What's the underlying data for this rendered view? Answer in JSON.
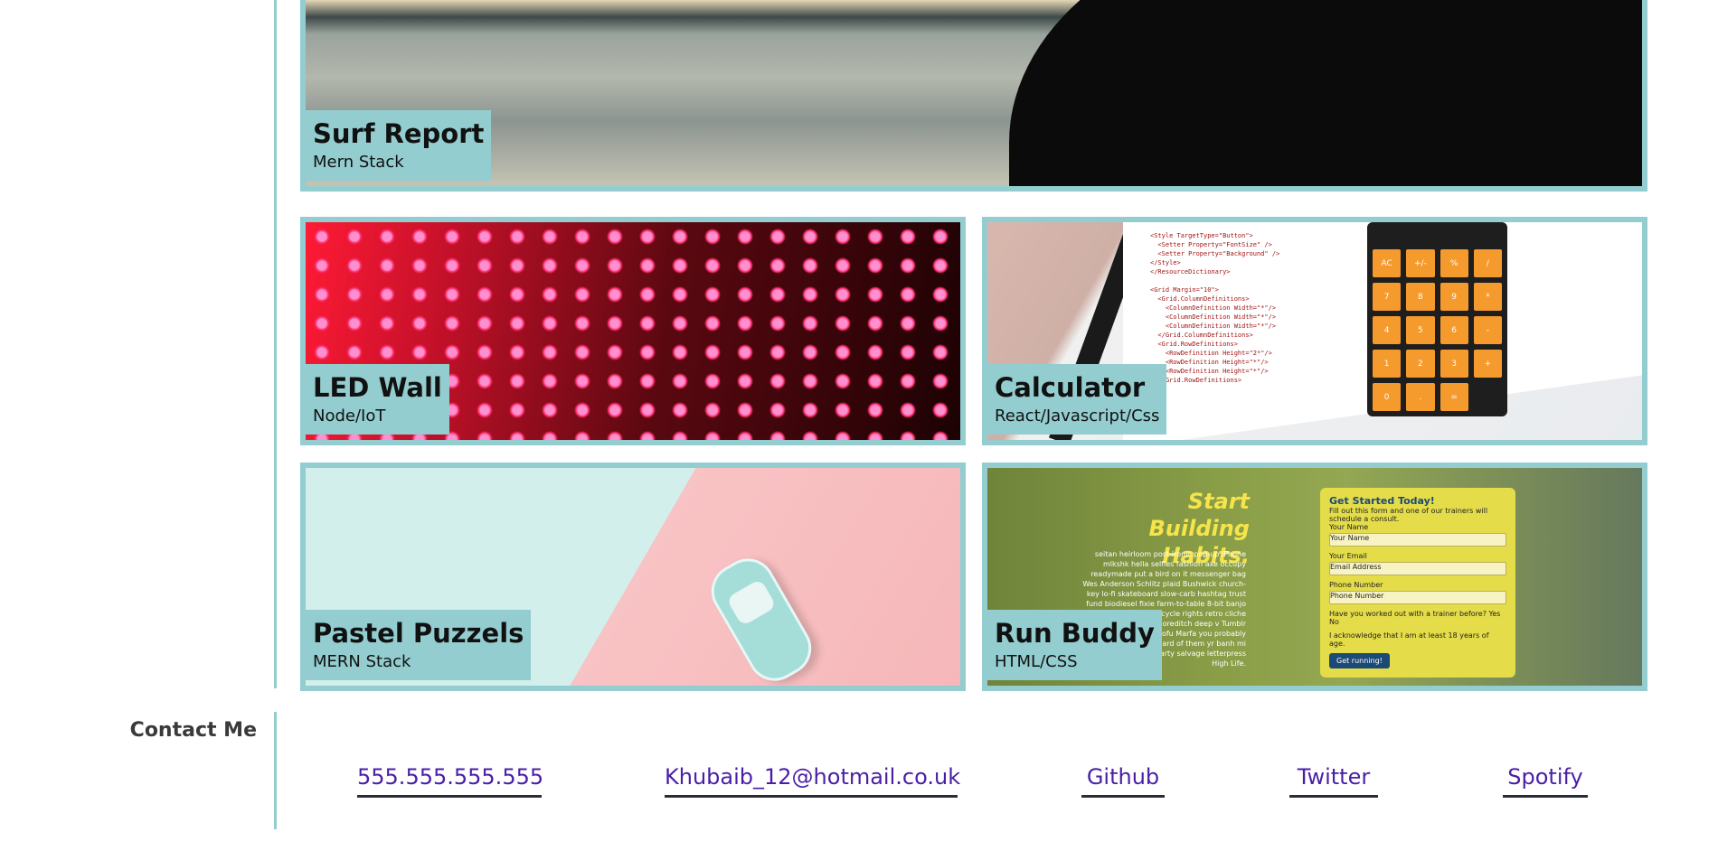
{
  "projects": [
    {
      "title": "Surf Report",
      "subtitle": "Mern Stack"
    },
    {
      "title": "LED Wall",
      "subtitle": "Node/IoT"
    },
    {
      "title": "Calculator",
      "subtitle": "React/Javascript/Css"
    },
    {
      "title": "Pastel Puzzels",
      "subtitle": "MERN Stack"
    },
    {
      "title": "Run Buddy",
      "subtitle": "HTML/CSS"
    }
  ],
  "runbuddy_art": {
    "headline": "Start Building Habits.",
    "paragraph": "seitan heirloom post-ironic pop-up iPhone mlkshk hella selfies fashion axe occupy readymade put a bird on it messenger bag Wes Anderson Schlitz plaid Bushwick church-key lo-fi skateboard slow-carb hashtag trust fund biodiesel fixie farm-to-table 8-bit banjo Banksy chillwave bicycle rights retro cliche irony mumblecore Shoreditch deep v Tumblr bitters cray gentrify tofu Marfa you probably haven't heard of them yr banh mi asymmetrical art party salvage letterpress High Life.",
    "form_title": "Get Started Today!",
    "form_intro": "Fill out this form and one of our trainers will schedule a consult.",
    "field_name": "Your Name",
    "field_name_placeholder": "Your Name",
    "field_email": "Your Email",
    "field_email_placeholder": "Email Address",
    "field_phone": "Phone Number",
    "field_phone_placeholder": "Phone Number",
    "question": "Have you worked out with a trainer before?",
    "yes": "Yes",
    "no": "No",
    "ack": "I acknowledge that I am at least 18 years of age.",
    "button": "Get running!"
  },
  "calc_keys": [
    "AC",
    "+/-",
    "%",
    "/",
    "7",
    "8",
    "9",
    "*",
    "4",
    "5",
    "6",
    "-",
    "1",
    "2",
    "3",
    "+",
    "0",
    ".",
    "="
  ],
  "contact": {
    "heading": "Contact Me",
    "links": [
      "555.555.555.555",
      "Khubaib_12@hotmail.co.uk",
      "Github",
      "Twitter",
      "Spotify"
    ]
  },
  "colors": {
    "accent": "#93cdcf",
    "link": "#4a1fa6",
    "underline": "#2c2c38"
  }
}
